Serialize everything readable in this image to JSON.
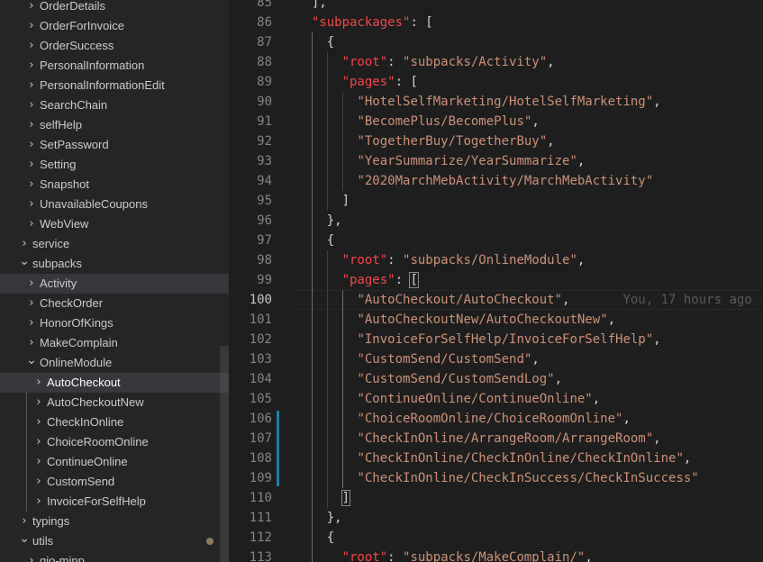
{
  "explorer": {
    "items": [
      {
        "label": "OrderDetails",
        "depth": 2,
        "type": "folder-collapsed"
      },
      {
        "label": "OrderForInvoice",
        "depth": 2,
        "type": "folder-collapsed"
      },
      {
        "label": "OrderSuccess",
        "depth": 2,
        "type": "folder-collapsed"
      },
      {
        "label": "PersonalInformation",
        "depth": 2,
        "type": "folder-collapsed"
      },
      {
        "label": "PersonalInformationEdit",
        "depth": 2,
        "type": "folder-collapsed"
      },
      {
        "label": "SearchChain",
        "depth": 2,
        "type": "folder-collapsed"
      },
      {
        "label": "selfHelp",
        "depth": 2,
        "type": "folder-collapsed"
      },
      {
        "label": "SetPassword",
        "depth": 2,
        "type": "folder-collapsed"
      },
      {
        "label": "Setting",
        "depth": 2,
        "type": "folder-collapsed"
      },
      {
        "label": "Snapshot",
        "depth": 2,
        "type": "folder-collapsed"
      },
      {
        "label": "UnavailableCoupons",
        "depth": 2,
        "type": "folder-collapsed"
      },
      {
        "label": "WebView",
        "depth": 2,
        "type": "folder-collapsed"
      },
      {
        "label": "service",
        "depth": 1,
        "type": "folder-collapsed"
      },
      {
        "label": "subpacks",
        "depth": 1,
        "type": "folder-expanded"
      },
      {
        "label": "Activity",
        "depth": 2,
        "type": "folder-collapsed",
        "state": "hover"
      },
      {
        "label": "CheckOrder",
        "depth": 2,
        "type": "folder-collapsed"
      },
      {
        "label": "HonorOfKings",
        "depth": 2,
        "type": "folder-collapsed"
      },
      {
        "label": "MakeComplain",
        "depth": 2,
        "type": "folder-collapsed"
      },
      {
        "label": "OnlineModule",
        "depth": 2,
        "type": "folder-expanded"
      },
      {
        "label": "AutoCheckout",
        "depth": 3,
        "type": "folder-collapsed",
        "state": "selected"
      },
      {
        "label": "AutoCheckoutNew",
        "depth": 3,
        "type": "folder-collapsed"
      },
      {
        "label": "CheckInOnline",
        "depth": 3,
        "type": "folder-collapsed"
      },
      {
        "label": "ChoiceRoomOnline",
        "depth": 3,
        "type": "folder-collapsed"
      },
      {
        "label": "ContinueOnline",
        "depth": 3,
        "type": "folder-collapsed"
      },
      {
        "label": "CustomSend",
        "depth": 3,
        "type": "folder-collapsed"
      },
      {
        "label": "InvoiceForSelfHelp",
        "depth": 3,
        "type": "folder-collapsed"
      },
      {
        "label": "typings",
        "depth": 1,
        "type": "folder-collapsed"
      },
      {
        "label": "utils",
        "depth": 1,
        "type": "folder-expanded",
        "modified": true
      },
      {
        "label": "gio-minp",
        "depth": 2,
        "type": "folder-collapsed"
      }
    ]
  },
  "editor": {
    "current_line": 100,
    "blame": "You, 17 hours ago",
    "lines": [
      {
        "n": 85,
        "indent": 1,
        "tokens": [
          {
            "t": "],",
            "c": "pun"
          }
        ]
      },
      {
        "n": 86,
        "indent": 1,
        "tokens": [
          {
            "t": "\"subpackages\"",
            "c": "key"
          },
          {
            "t": ": [",
            "c": "pun"
          }
        ]
      },
      {
        "n": 87,
        "indent": 2,
        "tokens": [
          {
            "t": "{",
            "c": "pun"
          }
        ]
      },
      {
        "n": 88,
        "indent": 3,
        "tokens": [
          {
            "t": "\"root\"",
            "c": "key"
          },
          {
            "t": ": ",
            "c": "pun"
          },
          {
            "t": "\"subpacks/Activity\"",
            "c": "str"
          },
          {
            "t": ",",
            "c": "pun"
          }
        ]
      },
      {
        "n": 89,
        "indent": 3,
        "tokens": [
          {
            "t": "\"pages\"",
            "c": "key"
          },
          {
            "t": ": [",
            "c": "pun"
          }
        ]
      },
      {
        "n": 90,
        "indent": 4,
        "tokens": [
          {
            "t": "\"HotelSelfMarketing/HotelSelfMarketing\"",
            "c": "str"
          },
          {
            "t": ",",
            "c": "pun"
          }
        ]
      },
      {
        "n": 91,
        "indent": 4,
        "tokens": [
          {
            "t": "\"BecomePlus/BecomePlus\"",
            "c": "str"
          },
          {
            "t": ",",
            "c": "pun"
          }
        ]
      },
      {
        "n": 92,
        "indent": 4,
        "tokens": [
          {
            "t": "\"TogetherBuy/TogetherBuy\"",
            "c": "str"
          },
          {
            "t": ",",
            "c": "pun"
          }
        ]
      },
      {
        "n": 93,
        "indent": 4,
        "tokens": [
          {
            "t": "\"YearSummarize/YearSummarize\"",
            "c": "str"
          },
          {
            "t": ",",
            "c": "pun"
          }
        ]
      },
      {
        "n": 94,
        "indent": 4,
        "tokens": [
          {
            "t": "\"2020MarchMebActivity/MarchMebActivity\"",
            "c": "str"
          }
        ]
      },
      {
        "n": 95,
        "indent": 3,
        "tokens": [
          {
            "t": "]",
            "c": "pun"
          }
        ]
      },
      {
        "n": 96,
        "indent": 2,
        "tokens": [
          {
            "t": "},",
            "c": "pun"
          }
        ]
      },
      {
        "n": 97,
        "indent": 2,
        "tokens": [
          {
            "t": "{",
            "c": "pun"
          }
        ]
      },
      {
        "n": 98,
        "indent": 3,
        "tokens": [
          {
            "t": "\"root\"",
            "c": "key"
          },
          {
            "t": ": ",
            "c": "pun"
          },
          {
            "t": "\"subpacks/OnlineModule\"",
            "c": "str"
          },
          {
            "t": ",",
            "c": "pun"
          }
        ]
      },
      {
        "n": 99,
        "indent": 3,
        "tokens": [
          {
            "t": "\"pages\"",
            "c": "key"
          },
          {
            "t": ": ",
            "c": "pun"
          },
          {
            "t": "[",
            "c": "pun",
            "bm": true
          }
        ]
      },
      {
        "n": 100,
        "indent": 4,
        "tokens": [
          {
            "t": "\"AutoCheckout/AutoCheckout\"",
            "c": "str"
          },
          {
            "t": ",",
            "c": "pun"
          }
        ],
        "blame": true
      },
      {
        "n": 101,
        "indent": 4,
        "tokens": [
          {
            "t": "\"AutoCheckoutNew/AutoCheckoutNew\"",
            "c": "str"
          },
          {
            "t": ",",
            "c": "pun"
          }
        ]
      },
      {
        "n": 102,
        "indent": 4,
        "tokens": [
          {
            "t": "\"InvoiceForSelfHelp/InvoiceForSelfHelp\"",
            "c": "str"
          },
          {
            "t": ",",
            "c": "pun"
          }
        ]
      },
      {
        "n": 103,
        "indent": 4,
        "tokens": [
          {
            "t": "\"CustomSend/CustomSend\"",
            "c": "str"
          },
          {
            "t": ",",
            "c": "pun"
          }
        ]
      },
      {
        "n": 104,
        "indent": 4,
        "tokens": [
          {
            "t": "\"CustomSend/CustomSendLog\"",
            "c": "str"
          },
          {
            "t": ",",
            "c": "pun"
          }
        ]
      },
      {
        "n": 105,
        "indent": 4,
        "tokens": [
          {
            "t": "\"ContinueOnline/ContinueOnline\"",
            "c": "str"
          },
          {
            "t": ",",
            "c": "pun"
          }
        ]
      },
      {
        "n": 106,
        "indent": 4,
        "tokens": [
          {
            "t": "\"ChoiceRoomOnline/ChoiceRoomOnline\"",
            "c": "str"
          },
          {
            "t": ",",
            "c": "pun"
          }
        ]
      },
      {
        "n": 107,
        "indent": 4,
        "tokens": [
          {
            "t": "\"CheckInOnline/ArrangeRoom/ArrangeRoom\"",
            "c": "str"
          },
          {
            "t": ",",
            "c": "pun"
          }
        ]
      },
      {
        "n": 108,
        "indent": 4,
        "tokens": [
          {
            "t": "\"CheckInOnline/CheckInOnline/CheckInOnline\"",
            "c": "str"
          },
          {
            "t": ",",
            "c": "pun"
          }
        ]
      },
      {
        "n": 109,
        "indent": 4,
        "tokens": [
          {
            "t": "\"CheckInOnline/CheckInSuccess/CheckInSuccess\"",
            "c": "str"
          }
        ]
      },
      {
        "n": 110,
        "indent": 3,
        "tokens": [
          {
            "t": "]",
            "c": "pun",
            "bm": true
          }
        ]
      },
      {
        "n": 111,
        "indent": 2,
        "tokens": [
          {
            "t": "},",
            "c": "pun"
          }
        ]
      },
      {
        "n": 112,
        "indent": 2,
        "tokens": [
          {
            "t": "{",
            "c": "pun"
          }
        ]
      },
      {
        "n": 113,
        "indent": 3,
        "tokens": [
          {
            "t": "\"root\"",
            "c": "key"
          },
          {
            "t": ": ",
            "c": "pun"
          },
          {
            "t": "\"subpacks/MakeComplain/\"",
            "c": "str"
          },
          {
            "t": ",",
            "c": "pun"
          }
        ]
      }
    ]
  }
}
